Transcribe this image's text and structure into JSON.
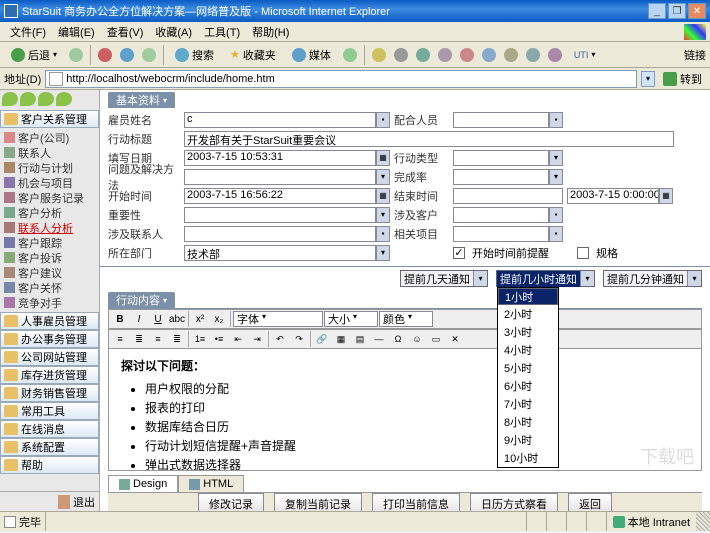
{
  "window": {
    "title": "StarSuit 商务办公全方位解决方案—网络普及版 - Microsoft Internet Explorer",
    "min": "_",
    "max": "❐",
    "close": "✕"
  },
  "menus": [
    "文件(F)",
    "编辑(E)",
    "查看(V)",
    "收藏(A)",
    "工具(T)",
    "帮助(H)"
  ],
  "toolbar": {
    "back": "后退",
    "search": "搜索",
    "fav": "收藏夹",
    "media": "媒体",
    "links": "链接"
  },
  "address": {
    "label": "地址(D)",
    "url": "http://localhost/webocrm/include/home.htm",
    "go": "转到"
  },
  "sidebar": {
    "groups": [
      {
        "label": "客户关系管理",
        "items": [
          {
            "l": "客户(公司)"
          },
          {
            "l": "联系人"
          },
          {
            "l": "行动与计划"
          },
          {
            "l": "机会与项目"
          },
          {
            "l": "客户服务记录"
          },
          {
            "l": "客户分析"
          },
          {
            "l": "联系人分析",
            "active": true
          },
          {
            "l": "客户跟踪"
          },
          {
            "l": "客户投诉"
          },
          {
            "l": "客户建议"
          },
          {
            "l": "客户关怀"
          },
          {
            "l": "竞争对手"
          }
        ]
      },
      {
        "label": "人事雇员管理"
      },
      {
        "label": "办公事务管理"
      },
      {
        "label": "公司网站管理"
      },
      {
        "label": "库存进货管理"
      },
      {
        "label": "财务销售管理"
      },
      {
        "label": "常用工具"
      },
      {
        "label": "在线消息"
      },
      {
        "label": "系统配置"
      },
      {
        "label": "帮助"
      }
    ],
    "exit": "退出"
  },
  "tabs": {
    "basic": "基本资料",
    "content": "行动内容"
  },
  "form": {
    "rows": {
      "name_l": "雇员姓名",
      "name_v": "c",
      "partner_l": "配合人员",
      "title_l": "行动标题",
      "title_v": "开发部有关于StarSuit重要会议",
      "date_l": "填写日期",
      "date_v": "2003-7-15 10:53:31",
      "type_l": "行动类型",
      "problem_l": "问题及解决方法",
      "rate_l": "完成率",
      "start_l": "开始时间",
      "start_v": "2003-7-15 16:56:22",
      "end_l": "结束时间",
      "end_v": "2003-7-15 0:00:00",
      "importance_l": "重要性",
      "cust_l": "涉及客户",
      "contact_l": "涉及联系人",
      "proj_l": "相关项目",
      "dept_l": "所在部门",
      "dept_v": "技术部",
      "remind_chk": "开始时间前提醒",
      "rules_chk": "规格"
    },
    "reminders": {
      "days": "提前几天通知",
      "hours": "提前几小时通知",
      "mins": "提前几分钟通知"
    },
    "hour_options": [
      "1小时",
      "2小时",
      "3小时",
      "4小时",
      "5小时",
      "6小时",
      "7小时",
      "8小时",
      "9小时",
      "10小时"
    ]
  },
  "editor": {
    "font": "字体",
    "size": "大小",
    "color": "颜色",
    "heading": "探讨以下问题：",
    "bullets": [
      "用户权限的分配",
      "报表的打印",
      "数据库结合日历",
      "行动计划短信提醒+声音提醒",
      "弹出式数据选择器"
    ]
  },
  "design_tabs": {
    "design": "Design",
    "html": "HTML"
  },
  "actions": {
    "modify": "修改记录",
    "copy": "复制当前记录",
    "print": "打印当前信息",
    "calview": "日历方式察看",
    "back": "返回"
  },
  "status": {
    "done": "完毕",
    "zone": "本地 Intranet"
  },
  "watermark": "下载吧"
}
